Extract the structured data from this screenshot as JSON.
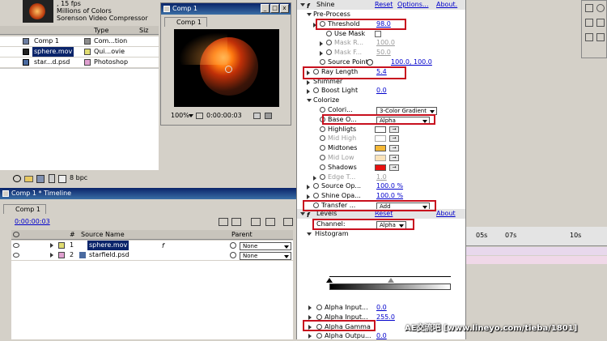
{
  "project": {
    "info_lines": [
      ", 15 fps",
      "Millions of Colors",
      "Sorenson Video Compressor"
    ],
    "columns": {
      "name": "",
      "type": "Type",
      "size": "Siz"
    },
    "items": [
      {
        "name": "Comp 1",
        "type": "Com...tion",
        "color": "#8c8c8c",
        "icon": "comp-icon"
      },
      {
        "name": "sphere.mov",
        "type": "Qui...ovie",
        "color": "#e0dc70",
        "icon": "movie-icon"
      },
      {
        "name": "star...d.psd",
        "type": "Photoshop",
        "color": "#e0a0d0",
        "icon": "psd-icon"
      }
    ],
    "bpc": "8 bpc"
  },
  "comp_window": {
    "title": "Comp 1",
    "tab": "Comp 1",
    "zoom": "100%",
    "timecode": "0:00:00:03"
  },
  "effects": {
    "effect_name": "Shine",
    "reset": "Reset",
    "options": "Options...",
    "about": "About.",
    "rows": [
      {
        "label": "Pre-Process",
        "indent": 1,
        "tri": "open"
      },
      {
        "label": "Threshold",
        "indent": 2,
        "tri": "closed",
        "sw": true,
        "value": "98.0"
      },
      {
        "label": "Use Mask",
        "indent": 3,
        "sw": true,
        "check": true
      },
      {
        "label": "Mask R...",
        "indent": 3,
        "tri": "closed",
        "sw": true,
        "value": "100.0",
        "disabled": true
      },
      {
        "label": "Mask F...",
        "indent": 3,
        "tri": "closed",
        "sw": true,
        "value": "50.0",
        "disabled": true
      },
      {
        "label": "Source Point",
        "indent": 2,
        "sw": true,
        "value": "100.0, 100.0",
        "crosshair": true
      },
      {
        "label": "Ray Length",
        "indent": 1,
        "tri": "closed",
        "sw": true,
        "value": "5.4"
      },
      {
        "label": "Shimmer",
        "indent": 1,
        "tri": "closed"
      },
      {
        "label": "Boost Light",
        "indent": 1,
        "tri": "closed",
        "sw": true,
        "value": "0.0"
      },
      {
        "label": "Colorize",
        "indent": 1,
        "tri": "open"
      },
      {
        "label": "Colori...",
        "indent": 2,
        "sw": true,
        "select": "3-Color Gradient"
      },
      {
        "label": "Base O...",
        "indent": 2,
        "sw": true,
        "select": "Alpha"
      },
      {
        "label": "Highligts",
        "indent": 2,
        "sw": true,
        "color": "#ffffff"
      },
      {
        "label": "Mid High",
        "indent": 2,
        "sw": true,
        "color": "#ffffff",
        "disabled": true
      },
      {
        "label": "Midtones",
        "indent": 2,
        "sw": true,
        "color": "#f5b836"
      },
      {
        "label": "Mid Low",
        "indent": 2,
        "sw": true,
        "color": "#f7c878",
        "disabled": true
      },
      {
        "label": "Shadows",
        "indent": 2,
        "sw": true,
        "color": "#e81010"
      },
      {
        "label": "Edge T...",
        "indent": 2,
        "tri": "closed",
        "sw": true,
        "value": "1.0",
        "disabled": true
      },
      {
        "label": "Source Op...",
        "indent": 1,
        "tri": "closed",
        "sw": true,
        "value": "100.0 %"
      },
      {
        "label": "Shine Opa...",
        "indent": 1,
        "tri": "closed",
        "sw": true,
        "value": "100.0 %"
      },
      {
        "label": "Transfer ...",
        "indent": 1,
        "sw": true,
        "select": "Add"
      }
    ],
    "levels": {
      "name": "Levels",
      "reset": "Reset",
      "about": "About",
      "channel_label": "Channel:",
      "channel_value": "Alpha",
      "histogram": "Histogram",
      "rows": [
        {
          "label": "Alpha Input...",
          "value": "0.0"
        },
        {
          "label": "Alpha Input...",
          "value": "255.0"
        },
        {
          "label": "Alpha Gamma",
          "value": ""
        },
        {
          "label": "Alpha Outpu...",
          "value": "0.0"
        }
      ]
    }
  },
  "timeline": {
    "title": "Comp 1 * Timeline",
    "tab": "Comp 1",
    "timecode": "0:00:00:03",
    "columns": {
      "num": "#",
      "source": "Source Name",
      "parent": "Parent"
    },
    "layers": [
      {
        "num": "1",
        "name": "sphere.mov",
        "label_color": "#e0dc70",
        "parent": "None",
        "selected": true
      },
      {
        "num": "2",
        "name": "starfield.psd",
        "label_color": "#e0a0d0",
        "parent": "None",
        "selected": false
      }
    ],
    "ruler": [
      "05s",
      "07s",
      "10s"
    ]
  },
  "watermark": "AE交流吧 [www.lineyo.com/tieba/1801]"
}
